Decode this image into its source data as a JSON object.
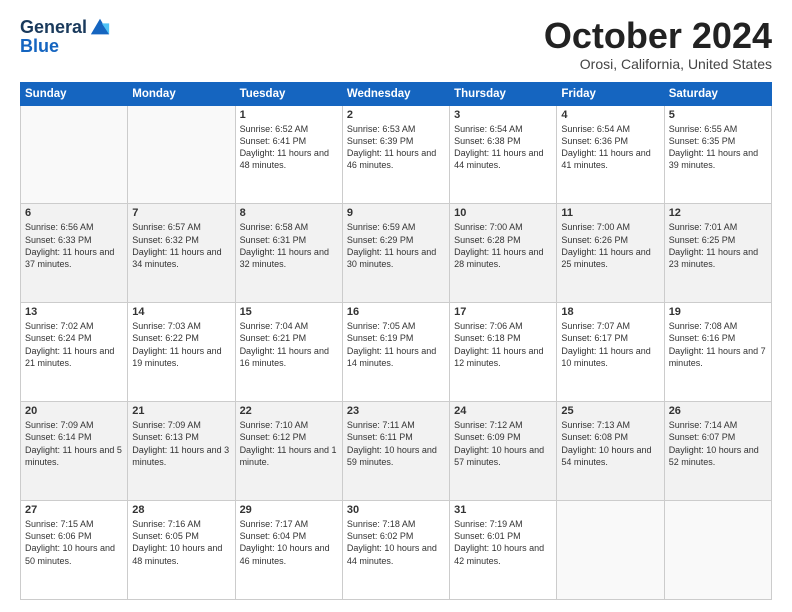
{
  "logo": {
    "part1": "General",
    "part2": "Blue"
  },
  "title": "October 2024",
  "location": "Orosi, California, United States",
  "days_of_week": [
    "Sunday",
    "Monday",
    "Tuesday",
    "Wednesday",
    "Thursday",
    "Friday",
    "Saturday"
  ],
  "weeks": [
    [
      {
        "day": "",
        "content": ""
      },
      {
        "day": "",
        "content": ""
      },
      {
        "day": "1",
        "content": "Sunrise: 6:52 AM\nSunset: 6:41 PM\nDaylight: 11 hours and 48 minutes."
      },
      {
        "day": "2",
        "content": "Sunrise: 6:53 AM\nSunset: 6:39 PM\nDaylight: 11 hours and 46 minutes."
      },
      {
        "day": "3",
        "content": "Sunrise: 6:54 AM\nSunset: 6:38 PM\nDaylight: 11 hours and 44 minutes."
      },
      {
        "day": "4",
        "content": "Sunrise: 6:54 AM\nSunset: 6:36 PM\nDaylight: 11 hours and 41 minutes."
      },
      {
        "day": "5",
        "content": "Sunrise: 6:55 AM\nSunset: 6:35 PM\nDaylight: 11 hours and 39 minutes."
      }
    ],
    [
      {
        "day": "6",
        "content": "Sunrise: 6:56 AM\nSunset: 6:33 PM\nDaylight: 11 hours and 37 minutes."
      },
      {
        "day": "7",
        "content": "Sunrise: 6:57 AM\nSunset: 6:32 PM\nDaylight: 11 hours and 34 minutes."
      },
      {
        "day": "8",
        "content": "Sunrise: 6:58 AM\nSunset: 6:31 PM\nDaylight: 11 hours and 32 minutes."
      },
      {
        "day": "9",
        "content": "Sunrise: 6:59 AM\nSunset: 6:29 PM\nDaylight: 11 hours and 30 minutes."
      },
      {
        "day": "10",
        "content": "Sunrise: 7:00 AM\nSunset: 6:28 PM\nDaylight: 11 hours and 28 minutes."
      },
      {
        "day": "11",
        "content": "Sunrise: 7:00 AM\nSunset: 6:26 PM\nDaylight: 11 hours and 25 minutes."
      },
      {
        "day": "12",
        "content": "Sunrise: 7:01 AM\nSunset: 6:25 PM\nDaylight: 11 hours and 23 minutes."
      }
    ],
    [
      {
        "day": "13",
        "content": "Sunrise: 7:02 AM\nSunset: 6:24 PM\nDaylight: 11 hours and 21 minutes."
      },
      {
        "day": "14",
        "content": "Sunrise: 7:03 AM\nSunset: 6:22 PM\nDaylight: 11 hours and 19 minutes."
      },
      {
        "day": "15",
        "content": "Sunrise: 7:04 AM\nSunset: 6:21 PM\nDaylight: 11 hours and 16 minutes."
      },
      {
        "day": "16",
        "content": "Sunrise: 7:05 AM\nSunset: 6:19 PM\nDaylight: 11 hours and 14 minutes."
      },
      {
        "day": "17",
        "content": "Sunrise: 7:06 AM\nSunset: 6:18 PM\nDaylight: 11 hours and 12 minutes."
      },
      {
        "day": "18",
        "content": "Sunrise: 7:07 AM\nSunset: 6:17 PM\nDaylight: 11 hours and 10 minutes."
      },
      {
        "day": "19",
        "content": "Sunrise: 7:08 AM\nSunset: 6:16 PM\nDaylight: 11 hours and 7 minutes."
      }
    ],
    [
      {
        "day": "20",
        "content": "Sunrise: 7:09 AM\nSunset: 6:14 PM\nDaylight: 11 hours and 5 minutes."
      },
      {
        "day": "21",
        "content": "Sunrise: 7:09 AM\nSunset: 6:13 PM\nDaylight: 11 hours and 3 minutes."
      },
      {
        "day": "22",
        "content": "Sunrise: 7:10 AM\nSunset: 6:12 PM\nDaylight: 11 hours and 1 minute."
      },
      {
        "day": "23",
        "content": "Sunrise: 7:11 AM\nSunset: 6:11 PM\nDaylight: 10 hours and 59 minutes."
      },
      {
        "day": "24",
        "content": "Sunrise: 7:12 AM\nSunset: 6:09 PM\nDaylight: 10 hours and 57 minutes."
      },
      {
        "day": "25",
        "content": "Sunrise: 7:13 AM\nSunset: 6:08 PM\nDaylight: 10 hours and 54 minutes."
      },
      {
        "day": "26",
        "content": "Sunrise: 7:14 AM\nSunset: 6:07 PM\nDaylight: 10 hours and 52 minutes."
      }
    ],
    [
      {
        "day": "27",
        "content": "Sunrise: 7:15 AM\nSunset: 6:06 PM\nDaylight: 10 hours and 50 minutes."
      },
      {
        "day": "28",
        "content": "Sunrise: 7:16 AM\nSunset: 6:05 PM\nDaylight: 10 hours and 48 minutes."
      },
      {
        "day": "29",
        "content": "Sunrise: 7:17 AM\nSunset: 6:04 PM\nDaylight: 10 hours and 46 minutes."
      },
      {
        "day": "30",
        "content": "Sunrise: 7:18 AM\nSunset: 6:02 PM\nDaylight: 10 hours and 44 minutes."
      },
      {
        "day": "31",
        "content": "Sunrise: 7:19 AM\nSunset: 6:01 PM\nDaylight: 10 hours and 42 minutes."
      },
      {
        "day": "",
        "content": ""
      },
      {
        "day": "",
        "content": ""
      }
    ]
  ]
}
